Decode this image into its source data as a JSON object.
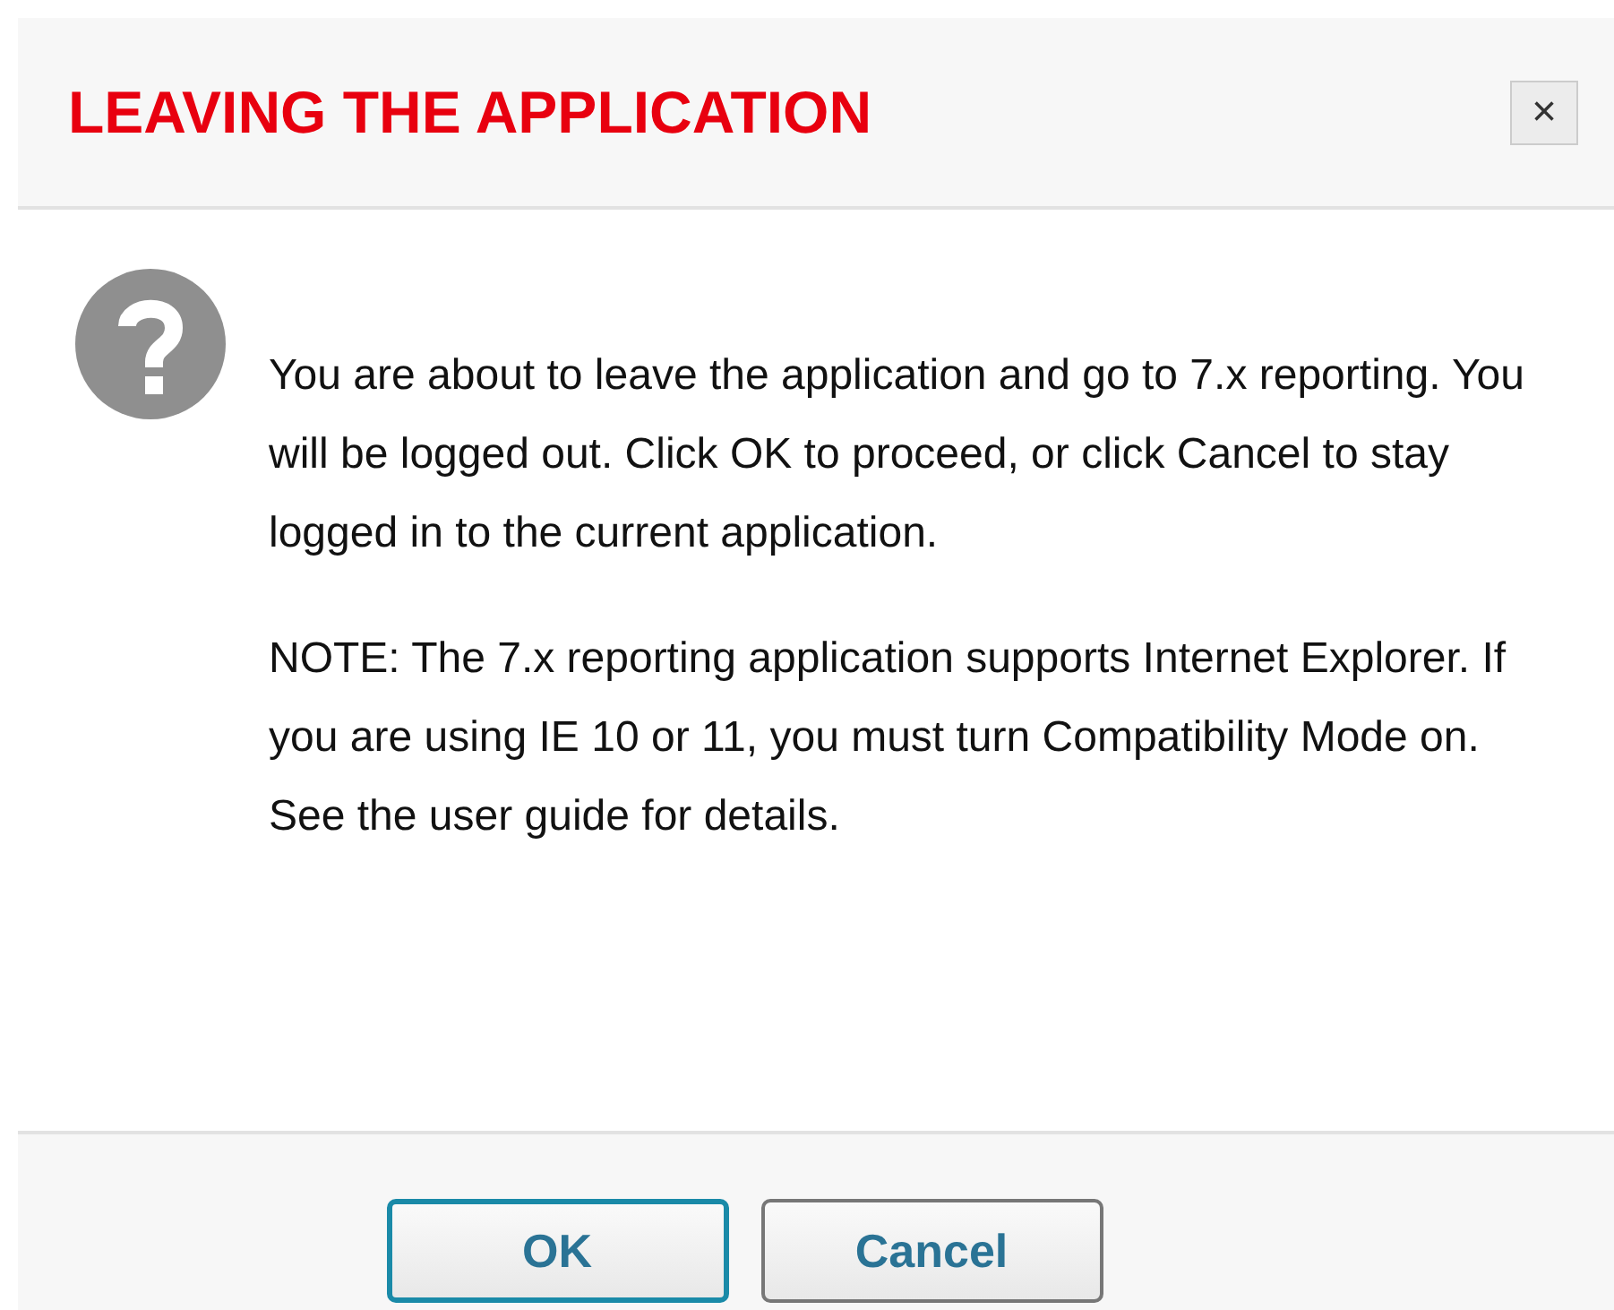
{
  "dialog": {
    "title": "LEAVING THE APPLICATION",
    "close": "×",
    "paragraphs": [
      "You are about to leave the application and go to 7.x reporting. You will be logged out. Click OK to proceed, or click Cancel to stay logged in to the current application.",
      "NOTE: The 7.x reporting application supports Internet Explorer. If you are using IE 10 or 11, you must turn Compatibility Mode on. See the user guide for details."
    ],
    "buttons": [
      {
        "label": "OK",
        "focused": true
      },
      {
        "label": "Cancel",
        "focused": false
      }
    ]
  }
}
